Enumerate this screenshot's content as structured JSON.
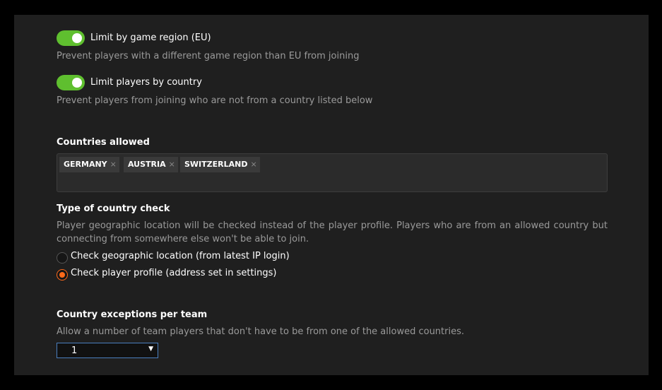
{
  "region_limit": {
    "toggle_on": true,
    "label": "Limit by game region (EU)",
    "description": "Prevent players with a different game region than EU from joining"
  },
  "country_limit": {
    "toggle_on": true,
    "label": "Limit players by country",
    "description": "Prevent players from joining who are not from a country listed below"
  },
  "countries_allowed": {
    "heading": "Countries allowed",
    "tags": [
      "GERMANY",
      "AUSTRIA",
      "SWITZERLAND"
    ],
    "remove_glyph": "⨯"
  },
  "country_check": {
    "heading": "Type of country check",
    "description": "Player geographic location will be checked instead of the player profile. Players who are from an allowed country but connecting from somewhere else won't be able to join.",
    "options": [
      {
        "label": "Check geographic location (from latest IP login)",
        "selected": false
      },
      {
        "label": "Check player profile (address set in settings)",
        "selected": true
      }
    ]
  },
  "team_exceptions": {
    "heading": "Country exceptions per team",
    "description": "Allow a number of team players that don't have to be from one of the allowed countries.",
    "selected_value": "1"
  },
  "colors": {
    "toggle_on": "#5fbf2f",
    "radio_selected": "#ff6a1a",
    "select_border": "#4a7fbf"
  }
}
